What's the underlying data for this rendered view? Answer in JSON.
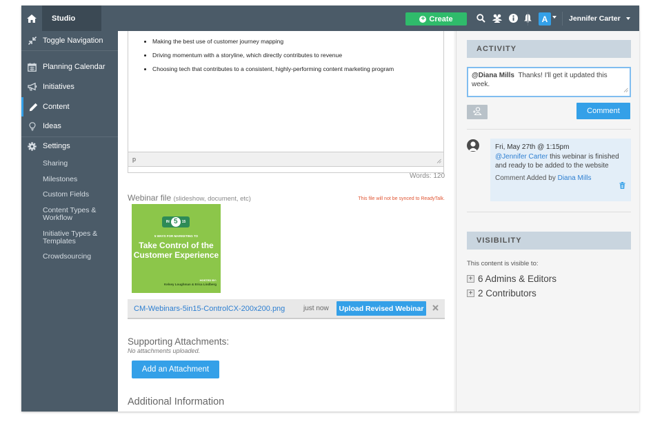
{
  "topbar": {
    "studio_label": "Studio",
    "create_label": "Create",
    "avatar_letter": "A",
    "user_name": "Jennifer Carter"
  },
  "sidebar": {
    "items": [
      {
        "label": "Toggle Navigation",
        "icon": "compress-icon"
      },
      {
        "label": "Planning Calendar",
        "icon": "calendar-icon"
      },
      {
        "label": "Initiatives",
        "icon": "megaphone-icon"
      },
      {
        "label": "Content",
        "icon": "pencil-icon"
      },
      {
        "label": "Ideas",
        "icon": "lightbulb-icon"
      },
      {
        "label": "Settings",
        "icon": "gear-icon"
      }
    ],
    "sub_items": [
      "Sharing",
      "Milestones",
      "Custom Fields",
      "Content Types &\nWorkflow",
      "Initiative Types &\nTemplates",
      "Crowdsourcing"
    ]
  },
  "editor": {
    "bullets": [
      "Making the best use of customer journey mapping",
      "Driving momentum with a storyline, which directly contributes to revenue",
      "Choosing tech that contributes to a consistent, highly-performing content marketing program"
    ],
    "status_path": "p",
    "word_count": "Words: 120"
  },
  "webinar": {
    "title": "Webinar file",
    "subtitle": "(slideshow, document, etc)",
    "sync_note": "This file will not be synced to ReadyTalk.",
    "thumb": {
      "badge_left": "IN",
      "badge_number": "5",
      "badge_right": "15",
      "kicker": "5 WAYS FOR MARKETING TO",
      "title": "Take Control of the Customer Experience",
      "hosted_by": "HOSTED BY:",
      "hosts": "Kelsey Loughman & Erica Lindberg"
    },
    "file_name": "CM-Webinars-5in15-ControlCX-200x200.png",
    "file_time": "just now",
    "upload_label": "Upload Revised Webinar"
  },
  "attachments": {
    "title": "Supporting Attachments:",
    "empty_text": "No attachments uploaded.",
    "add_label": "Add an Attachment"
  },
  "additional_info": "Additional Information",
  "activity": {
    "header": "ACTIVITY",
    "draft_mention": "@Diana Mills",
    "draft_text": "Thanks! I'll get it updated this week.",
    "comment_button": "Comment",
    "comment": {
      "date": "Fri, May 27th @ 1:15pm",
      "mention": "@Jennifer Carter",
      "text": "this webinar is finished and ready to be added to the website",
      "added_by_prefix": "Comment Added by",
      "added_by": "Diana Mills"
    }
  },
  "visibility": {
    "header": "VISIBILITY",
    "intro": "This content is visible to:",
    "groups": [
      "6 Admins & Editors",
      "2 Contributors"
    ]
  },
  "colors": {
    "topbar": "#4b5b68",
    "accent": "#34a0e8",
    "create": "#2fbb6b",
    "warning": "#e05533",
    "thumb": "#8cc64a"
  }
}
